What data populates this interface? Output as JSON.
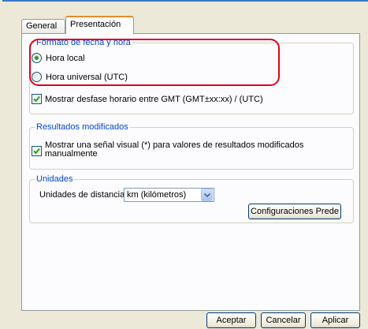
{
  "tabs": [
    {
      "label": "General",
      "active": false
    },
    {
      "label": "Presentación",
      "active": true
    }
  ],
  "date_time_group": {
    "legend": "Formato de fecha y hora",
    "options": [
      {
        "label": "Hora local",
        "selected": true
      },
      {
        "label": "Hora universal (UTC)",
        "selected": false
      }
    ],
    "gmt_offset": {
      "label": "Mostrar desfase horario entre GMT (GMT±xx:xx) / (UTC)",
      "checked": true
    }
  },
  "modified_results_group": {
    "legend": "Resultados modificados",
    "visual_signal": {
      "label_line1": "Mostrar una señal visual (*) para valores de resultados modificados",
      "label_line2": "manualmente",
      "checked": true
    }
  },
  "units_group": {
    "legend": "Unidades",
    "distance_label": "Unidades de distancia:",
    "distance_value": "km (kilómetros)",
    "config_button": "Configuraciones Prede"
  },
  "footer": {
    "accept": "Aceptar",
    "cancel": "Cancelar",
    "apply": "Aplicar"
  },
  "colors": {
    "highlight": "#e0001b",
    "legend": "#0046d5",
    "active_tab_accent": "#e68b2c"
  }
}
